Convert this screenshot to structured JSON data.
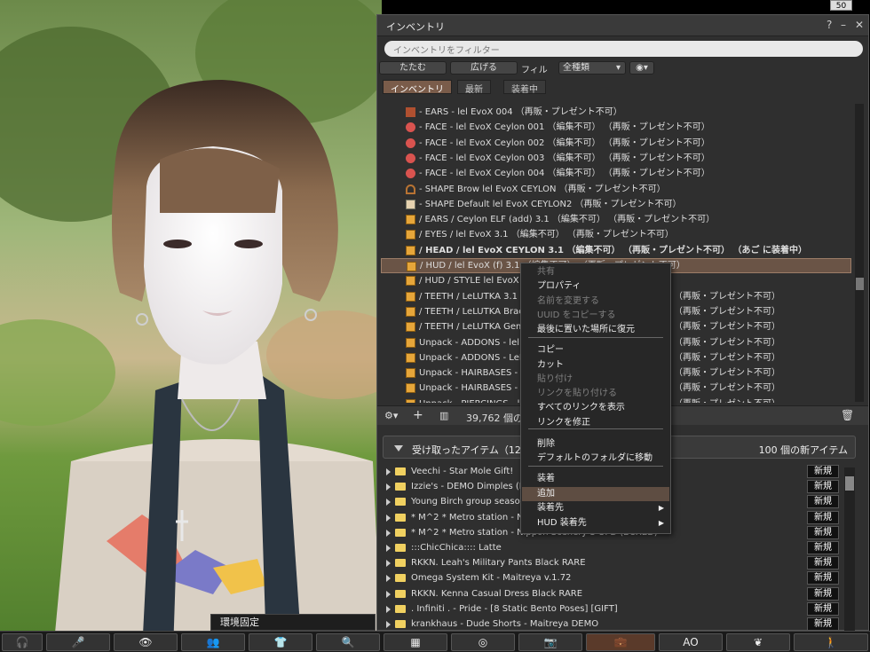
{
  "counter_badge": "50",
  "window": {
    "title": "インベントリ",
    "help_label": "?",
    "minimize_label": "–",
    "close_label": "✕",
    "filter_placeholder": "インベントリをフィルター",
    "collapse_label": "たたむ",
    "expand_label": "広げる",
    "filter_label": "フィル",
    "type_select_value": "全種類",
    "tabs": [
      {
        "label": "インベントリ",
        "active": true
      },
      {
        "label": "最新",
        "active": false
      },
      {
        "label": "装着中",
        "active": false
      }
    ]
  },
  "inventory_items": [
    {
      "icon": "ears-icon",
      "text": "- EARS - lel EvoX 004 （再販・プレゼント不可）"
    },
    {
      "icon": "face-icon",
      "text": "- FACE - lel EvoX Ceylon 001 （編集不可） （再販・プレゼント不可）"
    },
    {
      "icon": "face-icon",
      "text": "- FACE - lel EvoX Ceylon 002 （編集不可） （再販・プレゼント不可）"
    },
    {
      "icon": "face-icon",
      "text": "- FACE - lel EvoX Ceylon 003 （編集不可） （再販・プレゼント不可）"
    },
    {
      "icon": "face-icon",
      "text": "- FACE - lel EvoX Ceylon 004 （編集不可） （再販・プレゼント不可）"
    },
    {
      "icon": "shape-icon",
      "text": "- SHAPE Brow lel EvoX CEYLON （再販・プレゼント不可）"
    },
    {
      "icon": "shape-doc-icon",
      "text": "- SHAPE Default lel EvoX CEYLON2 （再販・プレゼント不可）"
    },
    {
      "icon": "box-icon",
      "text": "/ EARS / Ceylon ELF (add) 3.1 （編集不可） （再販・プレゼント不可）"
    },
    {
      "icon": "box-icon",
      "text": "/ EYES / lel EvoX 3.1 （編集不可） （再販・プレゼント不可）"
    },
    {
      "icon": "box-icon",
      "text": "/ HEAD / lel EvoX CEYLON 3.1 （編集不可） （再販・プレゼント不可） （あご に装着中）"
    },
    {
      "icon": "box-icon",
      "text": "/ HUD / lel EvoX (f) 3.1 （編集不可） （再販・プレゼント不可）"
    },
    {
      "icon": "box-icon",
      "text": "/ HUD / STYLE lel EvoX ("
    },
    {
      "icon": "box-icon",
      "text": "/ TEETH / LeLUTKA 3.1"
    },
    {
      "icon": "box-icon",
      "text": "/ TEETH / LeLUTKA Brac"
    },
    {
      "icon": "box-icon",
      "text": "/ TEETH / LeLUTKA Gem"
    },
    {
      "icon": "box-icon",
      "text": "Unpack - ADDONS - lel"
    },
    {
      "icon": "box-icon",
      "text": "Unpack - ADDONS - LeL"
    },
    {
      "icon": "box-icon",
      "text": "Unpack - HAIRBASES - l"
    },
    {
      "icon": "box-icon",
      "text": "Unpack - HAIRBASES - L"
    },
    {
      "icon": "box-icon",
      "text": "Unpack - PIERCINGS - le"
    }
  ],
  "inventory_tails": [
    "（再販・プレゼント不可）",
    "（再販・プレゼント不可）",
    "（再販・プレゼント不可）",
    "（再販・プレゼント不可）",
    "（再販・プレゼント不可）",
    "（再販・プレゼント不可）",
    "（再販・プレゼント不可）",
    "（再販・プレゼント不可）"
  ],
  "footer": {
    "item_count": "39,762 個の"
  },
  "received": {
    "label": "受け取ったアイテム（12",
    "new_count": "100 個の新アイテム",
    "new_badge": "新規",
    "items": [
      "Veechi - Star Mole Gift!",
      "Izzie's - DEMO Dimples (Le",
      "Young Birch group season",
      "* M^2 * Metro station - N",
      "* M^2 * Metro station - Nippon Scenery 3 UPD (BOXED)",
      ":::ChicChica:::: Latte",
      "RKKN. Leah's Military Pants Black RARE",
      "Omega System Kit - Maitreya v.1.72",
      "RKKN. Kenna Casual Dress Black RARE",
      ". Infiniti . - Pride - [8 Static Bento Poses] [GIFT]",
      "krankhaus - Dude Shorts - Maitreya DEMO"
    ]
  },
  "context_menu": {
    "items": [
      {
        "label": "共有",
        "disabled": true
      },
      {
        "label": "プロパティ",
        "disabled": false
      },
      {
        "label": "名前を変更する",
        "disabled": true
      },
      {
        "label": "UUID をコピーする",
        "disabled": true
      },
      {
        "label": "最後に置いた場所に復元",
        "disabled": false
      },
      {
        "label": "コピー",
        "disabled": false
      },
      {
        "label": "カット",
        "disabled": false
      },
      {
        "label": "貼り付け",
        "disabled": true
      },
      {
        "label": "リンクを貼り付ける",
        "disabled": true
      },
      {
        "label": "すべてのリンクを表示",
        "disabled": false
      },
      {
        "label": "リンクを修正",
        "disabled": false
      },
      {
        "label": "削除",
        "disabled": false
      },
      {
        "label": "デフォルトのフォルダに移動",
        "disabled": false
      },
      {
        "label": "装着",
        "disabled": false
      },
      {
        "label": "追加",
        "disabled": false,
        "highlighted": true
      },
      {
        "label": "装着先",
        "disabled": false,
        "submenu": true
      },
      {
        "label": "HUD 装着先",
        "disabled": false,
        "submenu": true
      }
    ]
  },
  "bottom_bar": {
    "env_fix": "環境固定",
    "ao_label": "AO"
  },
  "colors": {
    "selected_row": "#6a5446",
    "active_tab": "#7a5c4a",
    "box_icon": "#e6a63a",
    "face_icon": "#d9534f",
    "folder_icon": "#f0d060"
  }
}
